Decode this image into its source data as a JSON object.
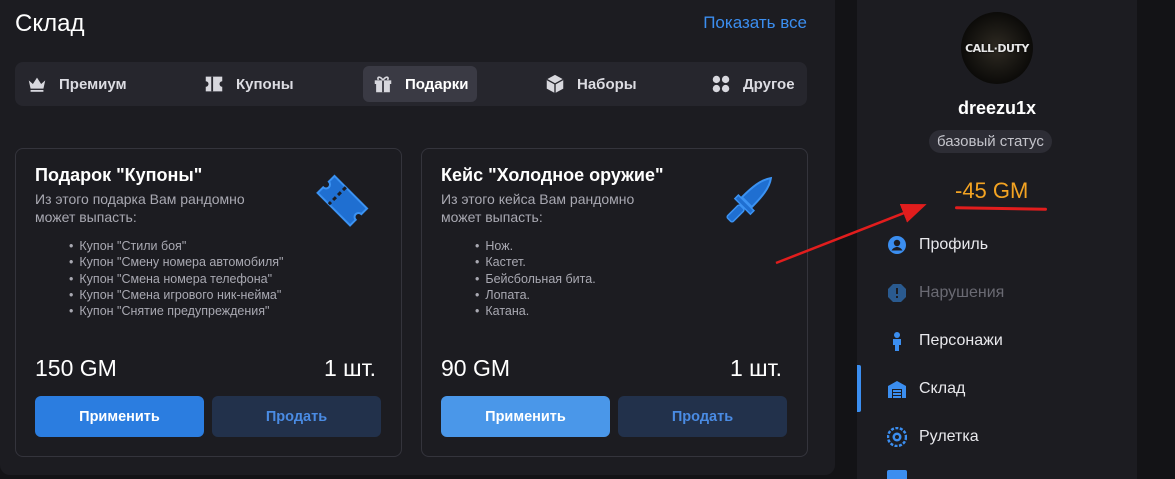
{
  "header": {
    "title": "Склад",
    "show_all": "Показать все"
  },
  "tabs": [
    {
      "label": "Премиум",
      "icon": "crown-icon"
    },
    {
      "label": "Купоны",
      "icon": "ticket-icon"
    },
    {
      "label": "Подарки",
      "icon": "gift-icon",
      "active": true
    },
    {
      "label": "Наборы",
      "icon": "box-icon"
    },
    {
      "label": "Другое",
      "icon": "dots-icon"
    }
  ],
  "cards": [
    {
      "title": "Подарок \"Купоны\"",
      "desc": "Из этого подарка Вам рандомно может выпасть:",
      "items": [
        "Купон \"Стили боя\"",
        "Купон \"Смену номера автомобиля\"",
        "Купон \"Смена номера телефона\"",
        "Купон \"Смена игрового ник-нейма\"",
        "Купон \"Снятие предупреждения\""
      ],
      "price": "150 GM",
      "qty": "1 шт.",
      "apply_label": "Применить",
      "sell_label": "Продать",
      "icon": "ticket-icon"
    },
    {
      "title": "Кейс \"Холодное оружие\"",
      "desc": "Из этого кейса Вам рандомно может выпасть:",
      "items": [
        "Нож.",
        "Кастет.",
        "Бейсбольная бита.",
        "Лопата.",
        "Катана."
      ],
      "price": "90 GM",
      "qty": "1 шт.",
      "apply_label": "Применить",
      "sell_label": "Продать",
      "icon": "knife-icon"
    }
  ],
  "profile": {
    "avatar_text": "CALL·DUTY",
    "username": "dreezu1x",
    "status": "базовый статус",
    "balance": "-45 GM"
  },
  "nav": [
    {
      "label": "Профиль",
      "icon": "user-circle-icon"
    },
    {
      "label": "Нарушения",
      "icon": "alert-octagon-icon",
      "muted": true
    },
    {
      "label": "Персонажи",
      "icon": "person-icon"
    },
    {
      "label": "Склад",
      "icon": "warehouse-icon",
      "active": true
    },
    {
      "label": "Рулетка",
      "icon": "roulette-icon"
    }
  ],
  "colors": {
    "accent": "#3b8ef0",
    "balance": "#f3a322",
    "annotation": "#e11d1d"
  }
}
